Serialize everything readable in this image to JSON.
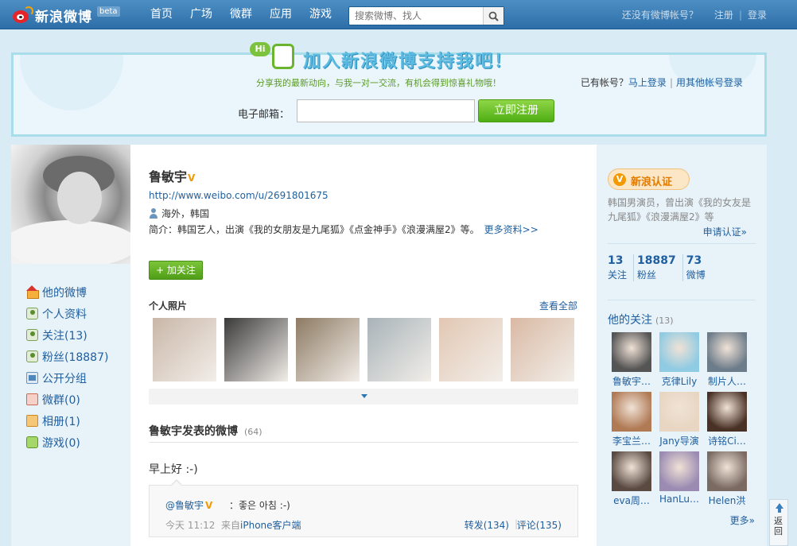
{
  "header": {
    "logo_text": "新浪微博",
    "beta": "beta",
    "nav": [
      "首页",
      "广场",
      "微群",
      "应用",
      "游戏"
    ],
    "search_placeholder": "搜索微博、找人",
    "no_account": "还没有微博帐号？",
    "register": "注册",
    "login": "登录"
  },
  "banner": {
    "hi": "Hi",
    "title": "加入新浪微博支持我吧！",
    "subtitle": "分享我的最新动向，与我一对一交流，有机会得到惊喜礼物哦！",
    "have_account": "已有帐号？",
    "login_now": "马上登录",
    "other_login": "用其他帐号登录",
    "email_label": "电子邮箱：",
    "register_button": "立即注册"
  },
  "profile": {
    "name": "鲁敏宇",
    "verified_mark": "V",
    "url": "http://www.weibo.com/u/2691801675",
    "location": "海外，韩国",
    "intro": "简介：韩国艺人，出演《我的女朋友是九尾狐》《点金神手》《浪漫满屋2》等。",
    "more_info": "更多资料>>",
    "follow_button": "+ 加关注"
  },
  "left_nav": [
    {
      "label": "他的微博",
      "icon": "home-icon"
    },
    {
      "label": "个人资料",
      "icon": "profile-icon"
    },
    {
      "label": "关注(13)",
      "icon": "follow-icon"
    },
    {
      "label": "粉丝(18887)",
      "icon": "fans-icon"
    },
    {
      "label": "公开分组",
      "icon": "group-icon"
    },
    {
      "label": "微群(0)",
      "icon": "weiqun-icon"
    },
    {
      "label": "相册(1)",
      "icon": "album-icon"
    },
    {
      "label": "游戏(0)",
      "icon": "game-icon"
    }
  ],
  "photos": {
    "title": "个人照片",
    "view_all": "查看全部",
    "colors": [
      "#c9b7a8",
      "#3a3a3a",
      "#8d7a63",
      "#a8b3b8",
      "#e2c7b3",
      "#d9b9a4"
    ]
  },
  "posts": {
    "title": "鲁敏宇发表的微博",
    "count": "(64)",
    "first_post": "早上好 :-)",
    "repost": {
      "user": "@鲁敏宇",
      "v": "V",
      "text": "：좋은 아침 :-)",
      "time": "今天 11:12",
      "source_prefix": "来自",
      "source": "iPhone客户端",
      "forward": "转发(134)",
      "sep": "|",
      "comment": "评论(135)"
    }
  },
  "right": {
    "verify_badge": "新浪认证",
    "verify_desc": "韩国男演员，曾出演《我的女友是九尾狐》《浪漫满屋2》等",
    "apply": "申请认证»",
    "stats": [
      {
        "n": "13",
        "l": "关注"
      },
      {
        "n": "18887",
        "l": "粉丝"
      },
      {
        "n": "73",
        "l": "微博"
      }
    ],
    "follows_title": "他的关注",
    "follows_count": "(13)",
    "follows": [
      {
        "name": "鲁敏宇…",
        "color": "#555"
      },
      {
        "name": "克律Lily",
        "color": "#8fcbe3"
      },
      {
        "name": "制片人…",
        "color": "#6d7c8a"
      },
      {
        "name": "李宝兰…",
        "color": "#b07a55"
      },
      {
        "name": "Jany导演",
        "color": "#e8d6c2"
      },
      {
        "name": "诗铭Ci…",
        "color": "#4a3126"
      },
      {
        "name": "eva周…",
        "color": "#5a4a42"
      },
      {
        "name": "HanLu…",
        "color": "#9b8ab2"
      },
      {
        "name": "Helen洪",
        "color": "#7a6a62"
      }
    ],
    "more": "更多»"
  },
  "back_to_top": "返回"
}
